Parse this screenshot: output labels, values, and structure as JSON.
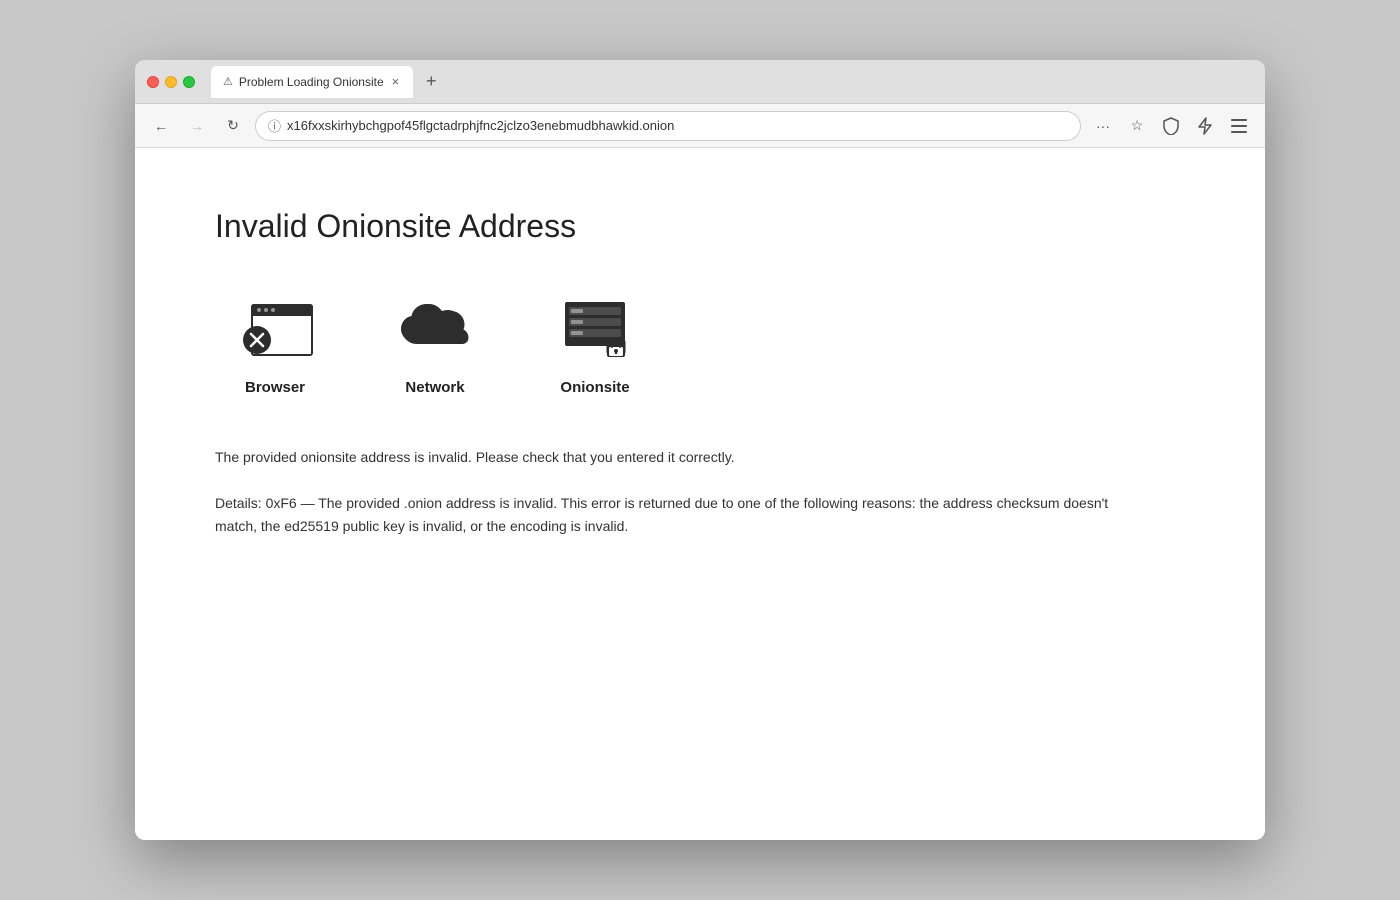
{
  "window": {
    "title": "Problem Loading Onionsite"
  },
  "tab": {
    "warning_icon": "⚠",
    "title": "Problem Loading Onionsite",
    "close_icon": "×"
  },
  "new_tab": {
    "icon": "+"
  },
  "nav": {
    "back_icon": "←",
    "forward_icon": "→",
    "reload_icon": "↻",
    "address_info_icon": "ⓘ",
    "url": "x16fxxskirhybchgpof45flgctadrphjfnc2jclzo3enebmudbhawkid.onion",
    "more_icon": "···",
    "bookmark_icon": "☆",
    "shield_icon": "🛡",
    "lightning_icon": "⚡",
    "menu_icon": "≡"
  },
  "page": {
    "title": "Invalid Onionsite Address",
    "icons": [
      {
        "id": "browser",
        "label": "Browser"
      },
      {
        "id": "network",
        "label": "Network"
      },
      {
        "id": "onionsite",
        "label": "Onionsite"
      }
    ],
    "description": "The provided onionsite address is invalid. Please check that you entered it correctly.",
    "details": "Details: 0xF6 — The provided .onion address is invalid. This error is returned due to one of the following reasons:\nthe address checksum doesn't match, the ed25519 public key is invalid, or the encoding is invalid."
  },
  "colors": {
    "icon_fill": "#2d2d2d",
    "text_dark": "#222222",
    "text_body": "#333333"
  }
}
